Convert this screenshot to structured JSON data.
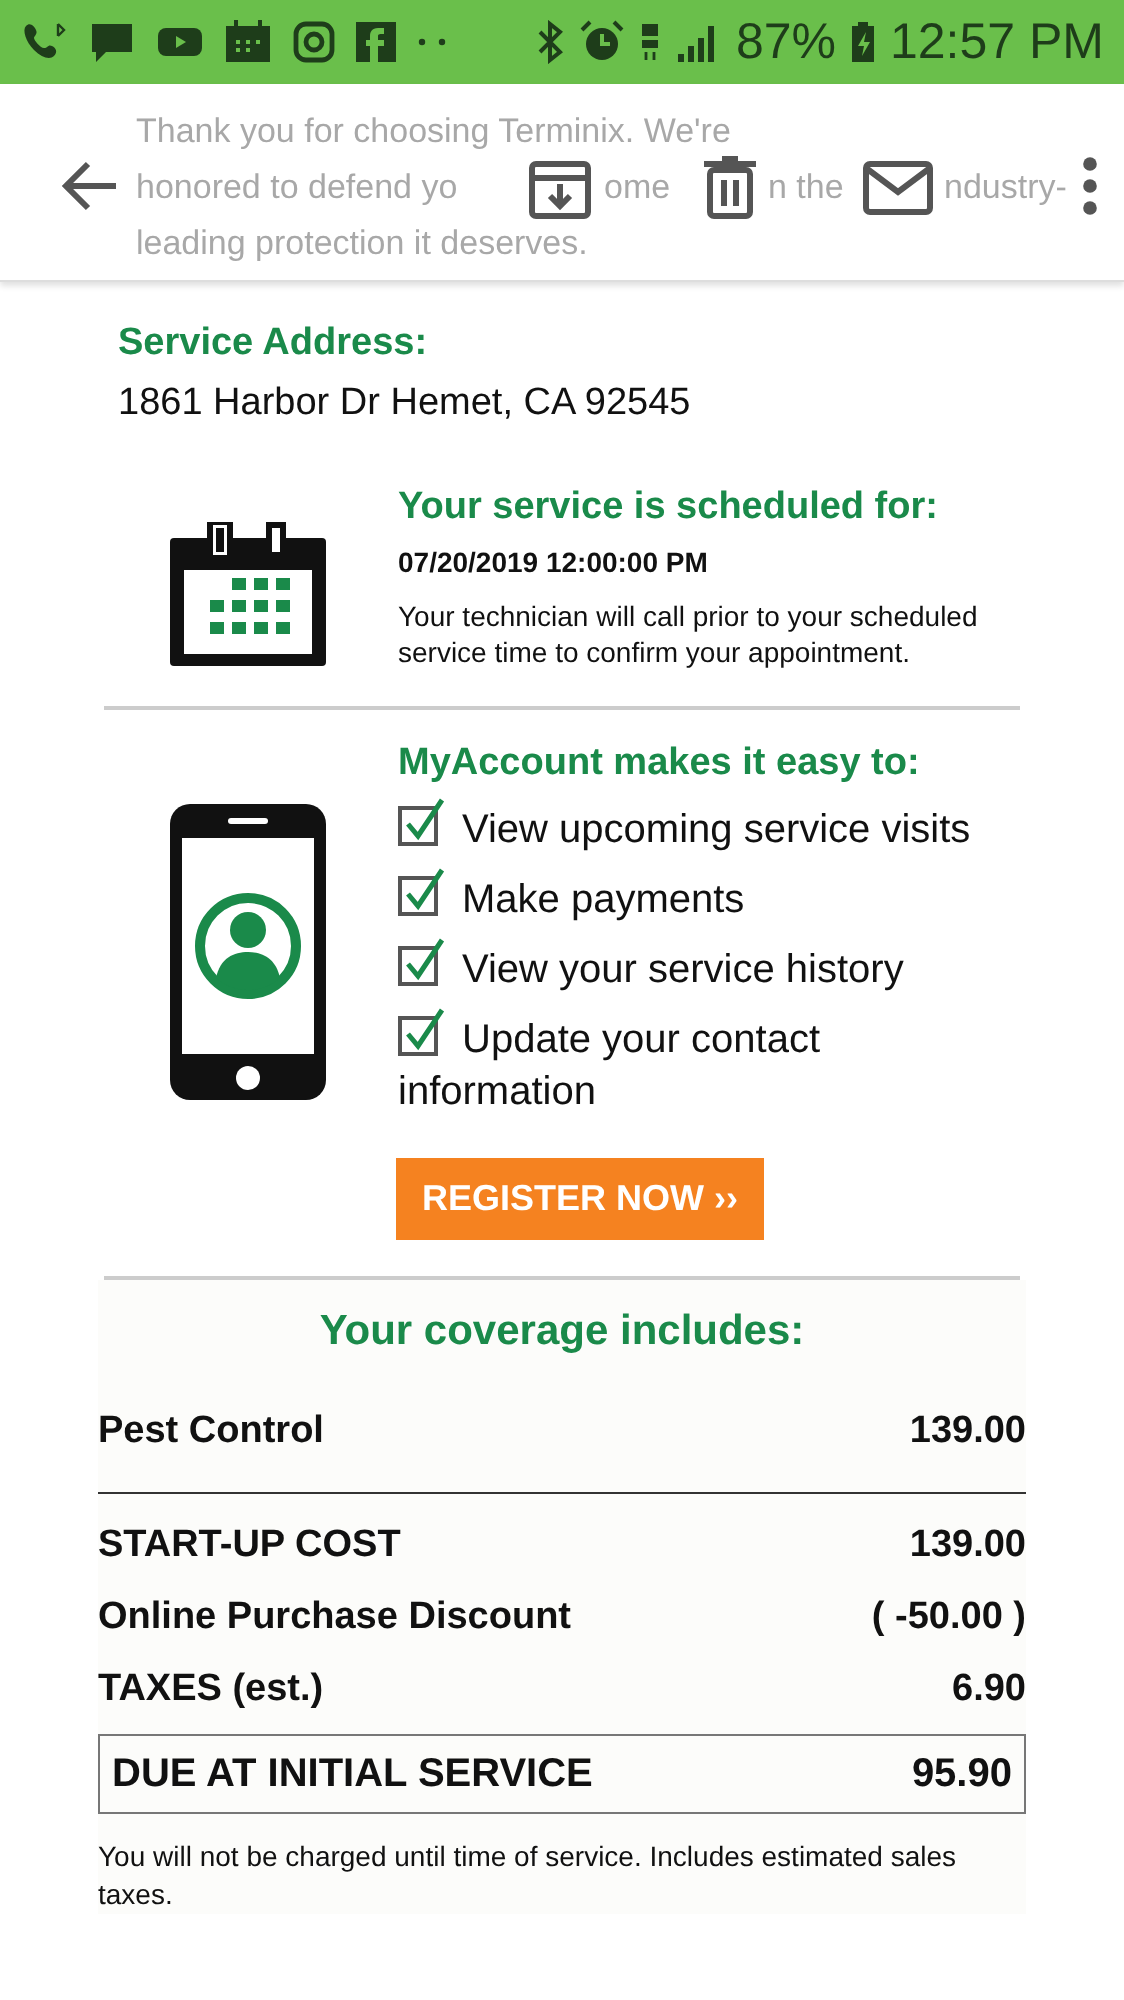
{
  "status_bar": {
    "battery": "87%",
    "time": "12:57 PM"
  },
  "preview_text": [
    "Thank you for choosing Terminix. We're",
    "honored to defend yo",
    "ome",
    "n the",
    "ndustry-",
    "leading protection it deserves."
  ],
  "service_address": {
    "label": "Service Address:",
    "value": "1861 Harbor Dr Hemet, CA 92545"
  },
  "schedule": {
    "heading": "Your service is scheduled for:",
    "datetime": "07/20/2019 12:00:00 PM",
    "note": "Your technician will call prior to your scheduled service time to confirm your appointment."
  },
  "myaccount": {
    "heading": "MyAccount makes it easy to:",
    "items": [
      {
        "label": "View upcoming service visits",
        "checked": true
      },
      {
        "label": "Make payments",
        "checked": true
      },
      {
        "label": "View your service history",
        "checked": true
      },
      {
        "label": "Update your contact information",
        "checked": true
      }
    ],
    "button": "REGISTER NOW ››"
  },
  "coverage": {
    "heading": "Your coverage includes:",
    "rows": [
      {
        "kind": "item",
        "label": "Pest Control",
        "amount": "139.00"
      },
      {
        "kind": "subtotal",
        "label": "START-UP COST",
        "amount": "139.00"
      },
      {
        "kind": "item",
        "label": "Online Purchase Discount",
        "amount": "( -50.00 )"
      },
      {
        "kind": "item",
        "label": "TAXES (est.)",
        "amount": "6.90"
      },
      {
        "kind": "total",
        "label": "DUE AT INITIAL SERVICE",
        "amount": "95.90"
      }
    ],
    "footnote": "You will not be charged until time of service. Includes estimated sales taxes."
  }
}
